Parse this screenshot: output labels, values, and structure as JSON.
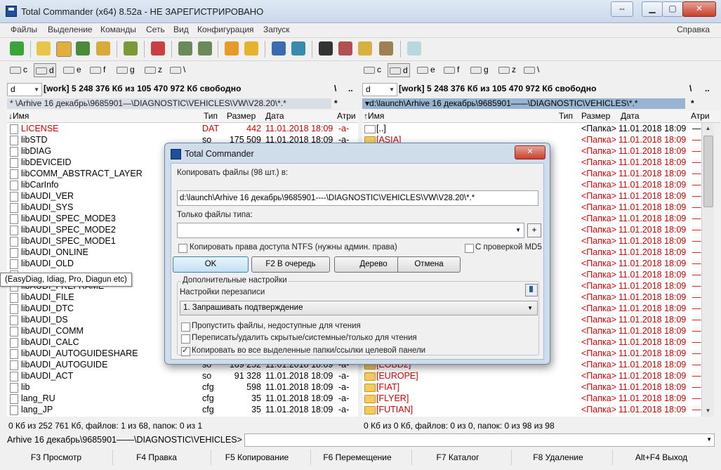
{
  "window": {
    "title": "Total Commander (x64) 8.52a - НЕ ЗАРЕГИСТРИРОВАНО",
    "restore_glyph": "⇔",
    "min_glyph": "▁",
    "max_glyph": "▢",
    "close_glyph": "✕"
  },
  "menu": {
    "items": [
      "Файлы",
      "Выделение",
      "Команды",
      "Сеть",
      "Вид",
      "Конфигурация",
      "Запуск"
    ],
    "help": "Справка"
  },
  "left": {
    "drives": [
      "c",
      "d",
      "e",
      "f",
      "g",
      "z",
      "\\"
    ],
    "drive_combo": "d",
    "free_info": "[work]  5 248 376 Кб из 105 470 972 Кб свободно",
    "nav_root": "\\",
    "nav_up": "..",
    "path": "* \\Arhive 16 декабрь\\9685901—\\DIAGNOSTIC\\VEHICLES\\VW\\V28.20\\*.*",
    "path_star": "*",
    "columns": {
      "name": "↓Имя",
      "type": "Тип",
      "size": "Размер",
      "date": "Дата",
      "attr": "Атри"
    },
    "rows": [
      {
        "name": "LICENSE",
        "type": "DAT",
        "size": "442",
        "date": "11.01.2018 18:09",
        "attr": "-a-",
        "red": true
      },
      {
        "name": "libSTD",
        "type": "so",
        "size": "175 509",
        "date": "11.01.2018 18:09",
        "attr": "-a-",
        "red": false
      },
      {
        "name": "libDIAG",
        "type": "",
        "size": "",
        "date": "",
        "attr": "",
        "red": false
      },
      {
        "name": "libDEVICEID",
        "type": "",
        "size": "",
        "date": "",
        "attr": "",
        "red": false
      },
      {
        "name": "libCOMM_ABSTRACT_LAYER",
        "type": "",
        "size": "",
        "date": "",
        "attr": "",
        "red": false
      },
      {
        "name": "libCarInfo",
        "type": "",
        "size": "",
        "date": "",
        "attr": "",
        "red": false
      },
      {
        "name": "libAUDI_VER",
        "type": "",
        "size": "",
        "date": "",
        "attr": "",
        "red": false
      },
      {
        "name": "libAUDI_SYS",
        "type": "",
        "size": "",
        "date": "",
        "attr": "",
        "red": false
      },
      {
        "name": "libAUDI_SPEC_MODE3",
        "type": "",
        "size": "",
        "date": "",
        "attr": "",
        "red": false
      },
      {
        "name": "libAUDI_SPEC_MODE2",
        "type": "",
        "size": "",
        "date": "",
        "attr": "",
        "red": false
      },
      {
        "name": "libAUDI_SPEC_MODE1",
        "type": "",
        "size": "",
        "date": "",
        "attr": "",
        "red": false
      },
      {
        "name": "libAUDI_ONLINE",
        "type": "",
        "size": "",
        "date": "",
        "attr": "",
        "red": false
      },
      {
        "name": "libAUDI_OLD",
        "type": "",
        "size": "",
        "date": "",
        "attr": "",
        "red": false
      },
      {
        "name": "",
        "type": "",
        "size": "",
        "date": "",
        "attr": "",
        "red": false
      },
      {
        "name": "libAUDI_FREFRAME",
        "type": "",
        "size": "",
        "date": "",
        "attr": "",
        "red": false
      },
      {
        "name": "libAUDI_FILE",
        "type": "",
        "size": "",
        "date": "",
        "attr": "",
        "red": false
      },
      {
        "name": "libAUDI_DTC",
        "type": "",
        "size": "",
        "date": "",
        "attr": "",
        "red": false
      },
      {
        "name": "libAUDI_DS",
        "type": "",
        "size": "",
        "date": "",
        "attr": "",
        "red": false
      },
      {
        "name": "libAUDI_COMM",
        "type": "",
        "size": "",
        "date": "",
        "attr": "",
        "red": false
      },
      {
        "name": "libAUDI_CALC",
        "type": "",
        "size": "",
        "date": "",
        "attr": "",
        "red": false
      },
      {
        "name": "libAUDI_AUTOGUIDESHARE",
        "type": "",
        "size": "",
        "date": "",
        "attr": "",
        "red": false
      },
      {
        "name": "libAUDI_AUTOGUIDE",
        "type": "so",
        "size": "169 252",
        "date": "11.01.2018 18:09",
        "attr": "-a-",
        "red": false
      },
      {
        "name": "libAUDI_ACT",
        "type": "so",
        "size": "91 328",
        "date": "11.01.2018 18:09",
        "attr": "-a-",
        "red": false
      },
      {
        "name": "lib",
        "type": "cfg",
        "size": "598",
        "date": "11.01.2018 18:09",
        "attr": "-a-",
        "red": false
      },
      {
        "name": "lang_RU",
        "type": "cfg",
        "size": "35",
        "date": "11.01.2018 18:09",
        "attr": "-a-",
        "red": false
      },
      {
        "name": "lang_JP",
        "type": "cfg",
        "size": "35",
        "date": "11.01.2018 18:09",
        "attr": "-a-",
        "red": false
      }
    ],
    "status": "0 Кб из 252 761 Кб, файлов: 1 из 68, папок: 0 из 1"
  },
  "right": {
    "drives": [
      "c",
      "d",
      "e",
      "f",
      "g",
      "z",
      "\\"
    ],
    "drive_combo": "d",
    "free_info": "[work]  5 248 376 Кб из 105 470 972 Кб свободно",
    "nav_root": "\\",
    "nav_up": "..",
    "path": "▾d:\\launch\\Arhive 16 декабрь\\9685901——\\DIAGNOSTIC\\VEHICLES\\*.*",
    "path_star": "*",
    "columns": {
      "name": "↑Имя",
      "type": "Тип",
      "size": "Размер",
      "date": "Дата",
      "attr": "Атри"
    },
    "rows": [
      {
        "name": "[..]",
        "size": "<Папка>",
        "date": "11.01.2018 18:09",
        "attr": "—",
        "red": false,
        "up": true
      },
      {
        "name": "[ASIA]",
        "size": "<Папка>",
        "date": "11.01.2018 18:09",
        "attr": "—",
        "red": true
      },
      {
        "name": "",
        "size": "<Папка>",
        "date": "11.01.2018 18:09",
        "attr": "—",
        "red": true
      },
      {
        "name": "",
        "size": "<Папка>",
        "date": "11.01.2018 18:09",
        "attr": "—",
        "red": true
      },
      {
        "name": "",
        "size": "<Папка>",
        "date": "11.01.2018 18:09",
        "attr": "—",
        "red": true
      },
      {
        "name": "",
        "size": "<Папка>",
        "date": "11.01.2018 18:09",
        "attr": "—",
        "red": true
      },
      {
        "name": "",
        "size": "<Папка>",
        "date": "11.01.2018 18:09",
        "attr": "—",
        "red": true
      },
      {
        "name": "",
        "size": "<Папка>",
        "date": "11.01.2018 18:09",
        "attr": "—",
        "red": true
      },
      {
        "name": "",
        "size": "<Папка>",
        "date": "11.01.2018 18:09",
        "attr": "—",
        "red": true
      },
      {
        "name": "",
        "size": "<Папка>",
        "date": "11.01.2018 18:09",
        "attr": "—",
        "red": true
      },
      {
        "name": "",
        "size": "<Папка>",
        "date": "11.01.2018 18:09",
        "attr": "—",
        "red": true
      },
      {
        "name": "",
        "size": "<Папка>",
        "date": "11.01.2018 18:09",
        "attr": "—",
        "red": true
      },
      {
        "name": "",
        "size": "<Папка>",
        "date": "11.01.2018 18:09",
        "attr": "—",
        "red": true
      },
      {
        "name": "",
        "size": "<Папка>",
        "date": "11.01.2018 18:09",
        "attr": "—",
        "red": true
      },
      {
        "name": "",
        "size": "<Папка>",
        "date": "11.01.2018 18:09",
        "attr": "—",
        "red": true
      },
      {
        "name": "",
        "size": "<Папка>",
        "date": "11.01.2018 18:09",
        "attr": "—",
        "red": true
      },
      {
        "name": "",
        "size": "<Папка>",
        "date": "11.01.2018 18:09",
        "attr": "—",
        "red": true
      },
      {
        "name": "",
        "size": "<Папка>",
        "date": "11.01.2018 18:09",
        "attr": "—",
        "red": true
      },
      {
        "name": "",
        "size": "<Папка>",
        "date": "11.01.2018 18:09",
        "attr": "—",
        "red": true
      },
      {
        "name": "",
        "size": "<Папка>",
        "date": "11.01.2018 18:09",
        "attr": "—",
        "red": true
      },
      {
        "name": "",
        "size": "<Папка>",
        "date": "11.01.2018 18:09",
        "attr": "—",
        "red": true
      },
      {
        "name": "[EOBD2]",
        "size": "<Папка>",
        "date": "11.01.2018 18:09",
        "attr": "—",
        "red": true
      },
      {
        "name": "[EUROPE]",
        "size": "<Папка>",
        "date": "11.01.2018 18:09",
        "attr": "—",
        "red": true
      },
      {
        "name": "[FIAT]",
        "size": "<Папка>",
        "date": "11.01.2018 18:09",
        "attr": "—",
        "red": true
      },
      {
        "name": "[FLYER]",
        "size": "<Папка>",
        "date": "11.01.2018 18:09",
        "attr": "—",
        "red": true
      },
      {
        "name": "[FUTIAN]",
        "size": "<Папка>",
        "date": "11.01.2018 18:09",
        "attr": "—",
        "red": true
      }
    ],
    "status": "0 Кб из 0 Кб, файлов: 0 из 0, папок: 0 из 98 из 98"
  },
  "tooltip": "(EasyDiag, Idiag, Pro, Diagun etc)",
  "cmdline": {
    "prompt": "Arhive 16 декабрь\\9685901——\\DIAGNOSTIC\\VEHICLES>",
    "value": ""
  },
  "fkeys": [
    "F3 Просмотр",
    "F4 Правка",
    "F5 Копирование",
    "F6 Перемещение",
    "F7 Каталог",
    "F8 Удаление",
    "Alt+F4 Выход"
  ],
  "dialog": {
    "title": "Total Commander",
    "copy_label": "Копировать файлы (98 шт.) в:",
    "copy_target": "d:\\launch\\Arhive 16 декабрь\\9685901----\\DIAGNOSTIC\\VEHICLES\\VW\\V28.20\\*.*",
    "filter_label": "Только файлы типа:",
    "filter_value": "",
    "plus": "+",
    "ntfs_label": "Копировать права доступа NTFS (нужны админ. права)",
    "md5_label": "С проверкой MD5",
    "buttons": {
      "ok": "OK",
      "queue": "F2 В очередь",
      "tree": "Дерево",
      "cancel": "Отмена"
    },
    "more_label": "Дополнительные настройки",
    "overwrite_label": "Настройки перезаписи",
    "overwrite_value": "1. Запрашивать подтверждение",
    "opt_skip": "Пропустить файлы, недоступные для чтения",
    "opt_hidden": "Переписать/удалить скрытые/системные/только для чтения",
    "opt_all": "Копировать во все выделенные папки/ссылки целевой панели",
    "checks": {
      "ntfs": false,
      "md5": false,
      "skip": false,
      "hidden": false,
      "all": true
    }
  }
}
